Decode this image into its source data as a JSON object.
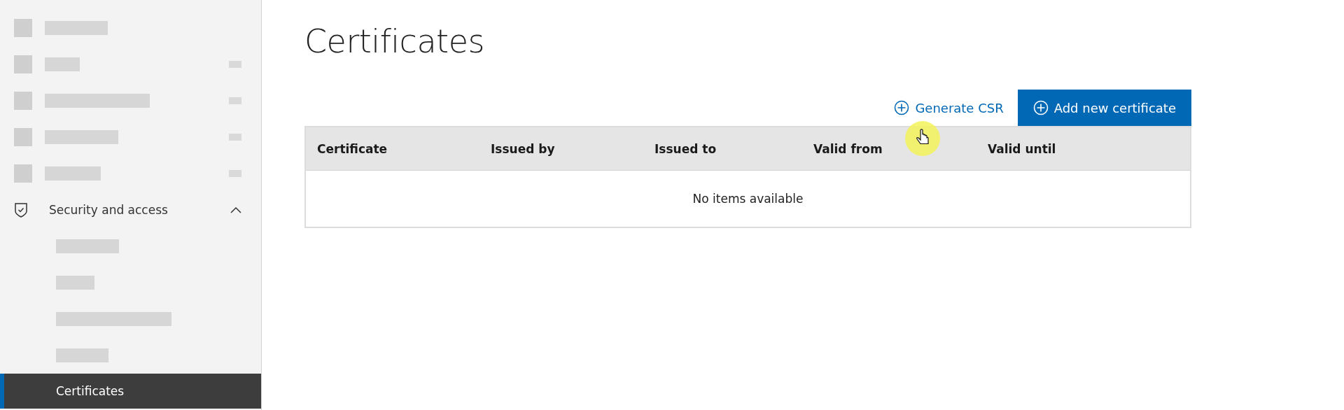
{
  "sidebar": {
    "items": [
      {
        "kind": "redacted",
        "chevron": false
      },
      {
        "kind": "redacted",
        "chevron": true
      },
      {
        "kind": "redacted",
        "chevron": true
      },
      {
        "kind": "redacted",
        "chevron": true
      },
      {
        "kind": "redacted",
        "chevron": true
      },
      {
        "kind": "group",
        "label": "Security and access",
        "expanded": true,
        "children": [
          {
            "kind": "redacted",
            "selected": false
          },
          {
            "kind": "redacted",
            "selected": false
          },
          {
            "kind": "redacted",
            "selected": false
          },
          {
            "kind": "redacted",
            "selected": false
          },
          {
            "kind": "link",
            "label": "Certificates",
            "selected": true
          }
        ]
      }
    ]
  },
  "page": {
    "title": "Certificates",
    "actions": [
      {
        "kind": "link",
        "label": "Generate CSR"
      },
      {
        "kind": "primary",
        "label": "Add new certificate"
      }
    ],
    "table": {
      "columns": [
        "Certificate",
        "Issued by",
        "Issued to",
        "Valid from",
        "Valid until"
      ],
      "empty_message": "No items available"
    }
  },
  "pointer": {
    "highlight": true
  }
}
